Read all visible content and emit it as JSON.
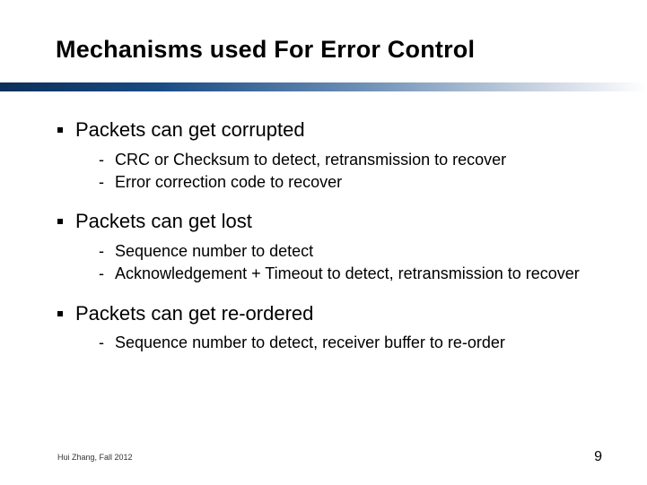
{
  "title": "Mechanisms used For Error Control",
  "items": [
    {
      "text": "Packets can get corrupted",
      "subs": [
        "CRC or Checksum to detect,  retransmission to recover",
        "Error correction code to recover"
      ]
    },
    {
      "text": "Packets can get lost",
      "subs": [
        "Sequence number to detect",
        "Acknowledgement + Timeout to detect, retransmission to recover"
      ]
    },
    {
      "text": "Packets can get re-ordered",
      "subs": [
        "Sequence number to detect, receiver buffer to re-order"
      ]
    }
  ],
  "footer": {
    "left": "Hui Zhang, Fall 2012",
    "number": "9"
  }
}
